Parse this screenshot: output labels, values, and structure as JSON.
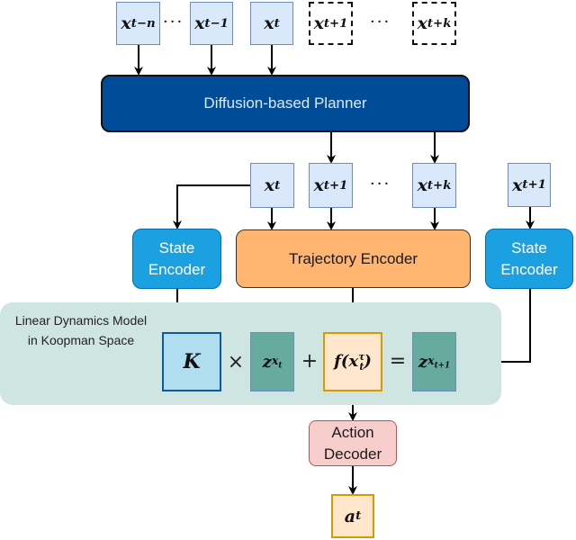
{
  "input_states": [
    {
      "base": "x",
      "sub": "t−n",
      "style": "solid"
    },
    {
      "base": "x",
      "sub": "t−1",
      "style": "solid"
    },
    {
      "base": "x",
      "sub": "t",
      "style": "solid"
    },
    {
      "base": "x",
      "sub": "t+1",
      "style": "dashed"
    },
    {
      "base": "x",
      "sub": "t+k",
      "style": "dashed"
    }
  ],
  "ellipsis": "···",
  "planner": {
    "label": "Diffusion-based Planner"
  },
  "planned_states": [
    {
      "base": "x",
      "sub": "t"
    },
    {
      "base": "x",
      "sub": "t+1"
    },
    {
      "base": "x",
      "sub": "t+k"
    }
  ],
  "next_state": {
    "base": "x",
    "sub": "t+1"
  },
  "state_encoder_left": {
    "line1": "State",
    "line2": "Encoder"
  },
  "state_encoder_right": {
    "line1": "State",
    "line2": "Encoder"
  },
  "trajectory_encoder": {
    "label": "Trajectory Encoder"
  },
  "koopman": {
    "title_line1": "Linear Dynamics Model",
    "title_line2": "in Koopman Space",
    "K": "K",
    "times": "×",
    "plus": "+",
    "equals": "=",
    "z_t": {
      "base": "z",
      "sub": "x",
      "subsub": "t"
    },
    "f": {
      "text": "f(x",
      "sup": "τ",
      "sub": "t",
      "close": ")"
    },
    "z_t1": {
      "base": "z",
      "sub": "x",
      "subsub": "t+1"
    }
  },
  "action_decoder": {
    "line1": "Action",
    "line2": "Decoder"
  },
  "action": {
    "base": "a",
    "sub": "t"
  },
  "colors": {
    "state_fill": "#dae8fc",
    "planner_fill": "#004c99",
    "encoder_fill": "#1ba1e2",
    "trajectory_fill": "#ffb570",
    "koopman_bg": "#cfe5e1",
    "latent_fill": "#67ab9f",
    "decoder_fill": "#f8cecc"
  }
}
